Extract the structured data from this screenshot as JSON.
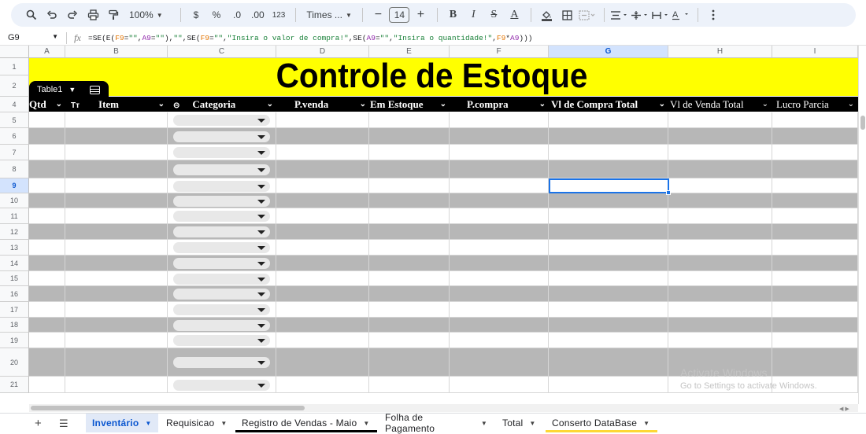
{
  "toolbar": {
    "zoom": "100%",
    "currency": "$",
    "percent": "%",
    "dec_decrease": ".0",
    "dec_increase": ".00",
    "number_format": "123",
    "font": "Times ...",
    "font_size": "14",
    "minus": "−",
    "plus": "+",
    "bold": "B",
    "italic": "I",
    "strike": "S",
    "text_color": "A"
  },
  "formula_bar": {
    "cell_ref": "G9",
    "fx": "fx",
    "formula_parts": {
      "p1": "=SE(E(",
      "p2": "F9",
      "p3": "=",
      "p4": "\"\"",
      "p5": ",",
      "p6": "A9",
      "p7": "=",
      "p8": "\"\"",
      "p9": "),",
      "p10": "\"\"",
      "p11": ",SE(",
      "p12": "F9",
      "p13": "=",
      "p14": "\"\"",
      "p15": ",",
      "p16": "\"Insira o valor de compra!\"",
      "p17": ",SE(",
      "p18": "A9",
      "p19": "=",
      "p20": "\"\"",
      "p21": ",",
      "p22": "\"Insira o quantidade!\"",
      "p23": ",",
      "p24": "F9",
      "p25": "*",
      "p26": "A9",
      "p27": ")))"
    }
  },
  "columns": [
    "A",
    "B",
    "C",
    "D",
    "E",
    "F",
    "G",
    "H",
    "I"
  ],
  "selected_column": "G",
  "rows": [
    "1",
    "2",
    "4",
    "5",
    "6",
    "7",
    "8",
    "9",
    "10",
    "11",
    "12",
    "13",
    "14",
    "15",
    "16",
    "17",
    "18",
    "19",
    "20",
    "21"
  ],
  "selected_row": "9",
  "sheet_title": "Controle de Estoque",
  "table_name": "Table1",
  "table_headers": {
    "qtd": "Qtd",
    "item_icon": "Tт",
    "item": "Item",
    "categoria": "Categoria",
    "pvenda": "P.venda",
    "em_estoque": "Em Estoque",
    "pcompra": "P.compra",
    "vl_compra_total": "Vl de Compra Total",
    "vl_venda_total": "Vl de Venda Total",
    "lucro_parcial": "Lucro Parcia"
  },
  "watermark": {
    "line1": "Activate Windows",
    "line2": "Go to Settings to activate Windows."
  },
  "tabs": [
    {
      "label": "Inventário",
      "active": true
    },
    {
      "label": "Requisicao",
      "active": false
    },
    {
      "label": "Registro de Vendas - Maio",
      "active": false
    },
    {
      "label": "Folha de Pagamento",
      "active": false
    },
    {
      "label": "Total",
      "active": false
    },
    {
      "label": "Conserto DataBase",
      "active": false
    }
  ],
  "colors": {
    "title_band": "#ffff00",
    "header_row": "#000000",
    "stripe": "#b7b7b7",
    "selection": "#1a73e8",
    "tab_underline_registro": "#000000",
    "tab_underline_conserto": "#fdd835"
  }
}
